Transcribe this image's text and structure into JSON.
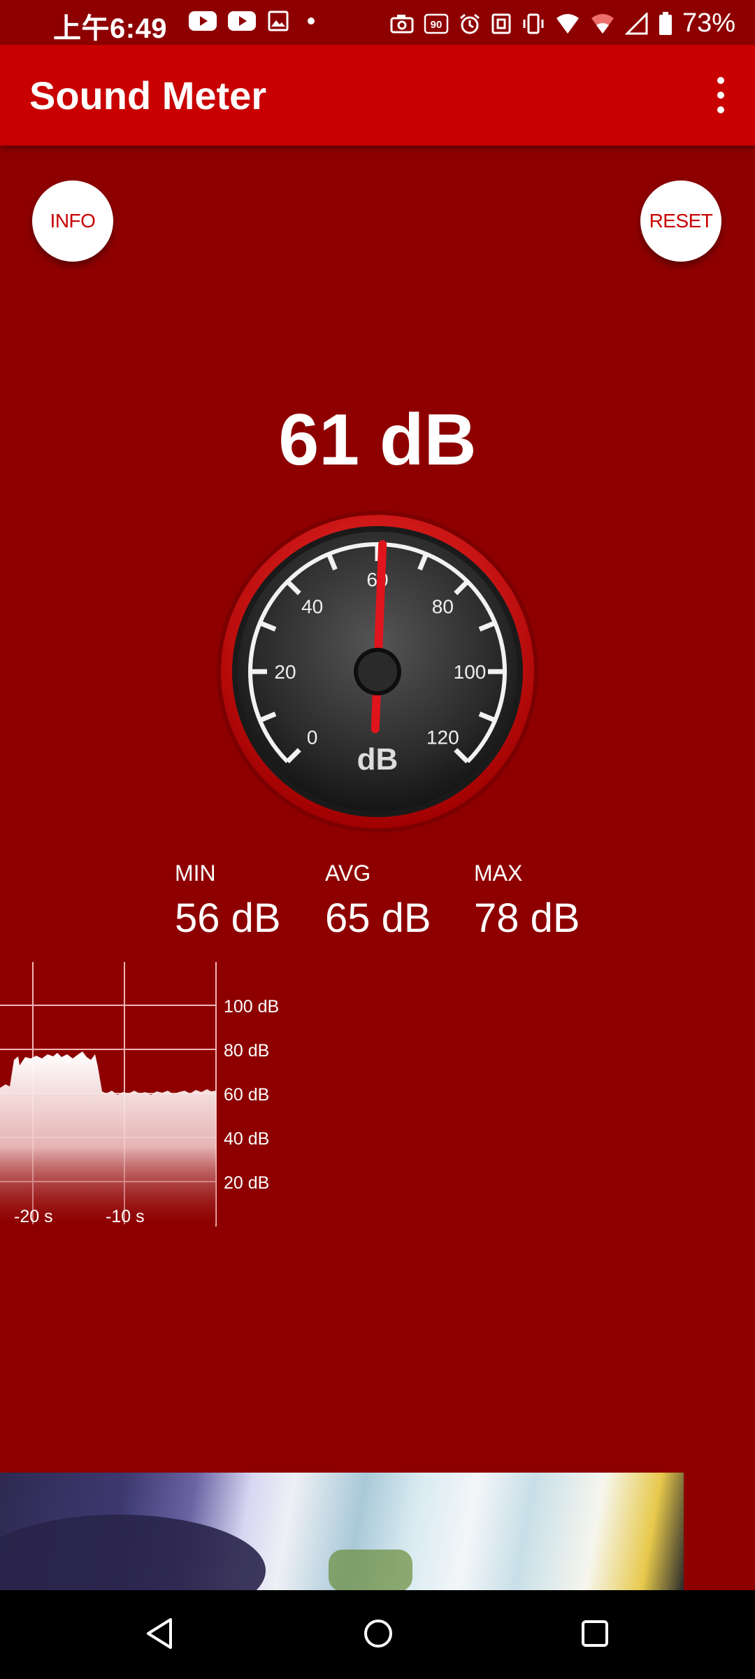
{
  "status_bar": {
    "time": "上午6:49",
    "battery": "73%",
    "icons": [
      "youtube-icon",
      "youtube-icon",
      "image-icon",
      "dot-icon",
      "camera-icon",
      "90hz-icon",
      "alarm-icon",
      "nfc-icon",
      "vibrate-icon",
      "wifi-icon",
      "wifi-icon",
      "signal-icon",
      "battery-icon"
    ]
  },
  "app_bar": {
    "title": "Sound Meter"
  },
  "buttons": {
    "info": "INFO",
    "reset": "RESET"
  },
  "reading": {
    "value": "61 dB"
  },
  "gauge": {
    "unit": "dB",
    "scale_labels": [
      "0",
      "20",
      "40",
      "60",
      "80",
      "100",
      "120"
    ],
    "needle_value": 61,
    "min": 0,
    "max": 120,
    "accent": "#e0141c"
  },
  "stats": {
    "min": {
      "label": "MIN",
      "value": "56 dB"
    },
    "avg": {
      "label": "AVG",
      "value": "65 dB"
    },
    "max": {
      "label": "MAX",
      "value": "78 dB"
    }
  },
  "history": {
    "y_labels": [
      "100 dB",
      "80 dB",
      "60 dB",
      "40 dB",
      "20 dB"
    ],
    "x_labels": [
      "-20 s",
      "-10 s"
    ]
  },
  "colors": {
    "background": "#8e0000",
    "app_bar": "#c80000",
    "nav_bar": "#000000"
  }
}
